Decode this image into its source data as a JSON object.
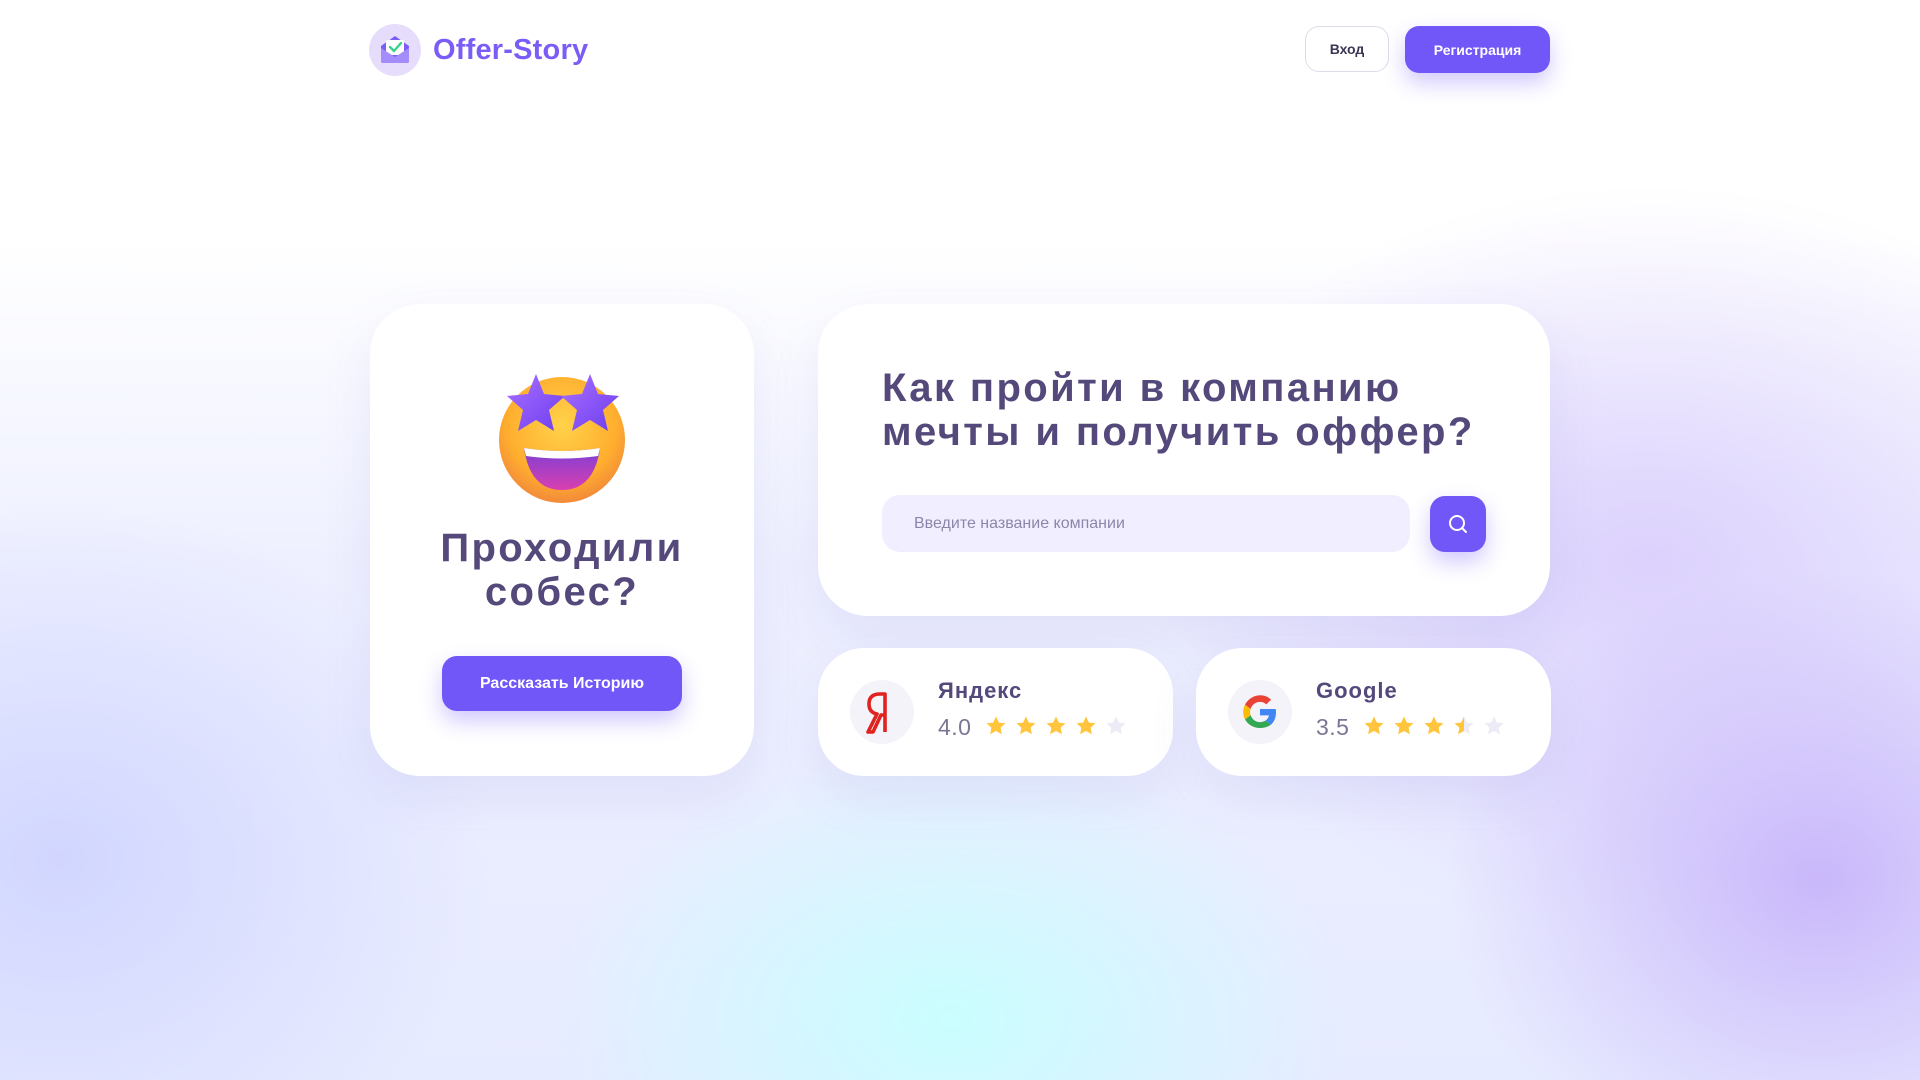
{
  "header": {
    "logo_text": "Offer-Story",
    "login_label": "Вход",
    "register_label": "Регистрация"
  },
  "story_card": {
    "title_line1": "Проходили",
    "title_line2": "собес?",
    "button_label": "Рассказать Историю"
  },
  "search_card": {
    "headline_line1": "Как пройти в компанию",
    "headline_line2": "мечты и получить оффер?",
    "placeholder": "Введите название компании"
  },
  "ratings": [
    {
      "name": "Яндекс",
      "score": "4.0",
      "stars": 4.0,
      "icon": "yandex-logo"
    },
    {
      "name": "Google",
      "score": "3.5",
      "stars": 3.5,
      "icon": "google-logo"
    }
  ],
  "colors": {
    "accent": "#7157f8",
    "logo": "#7c5cf7",
    "heading": "#54497a",
    "star_filled": "#ffc53d",
    "star_empty": "#ecebf6"
  }
}
